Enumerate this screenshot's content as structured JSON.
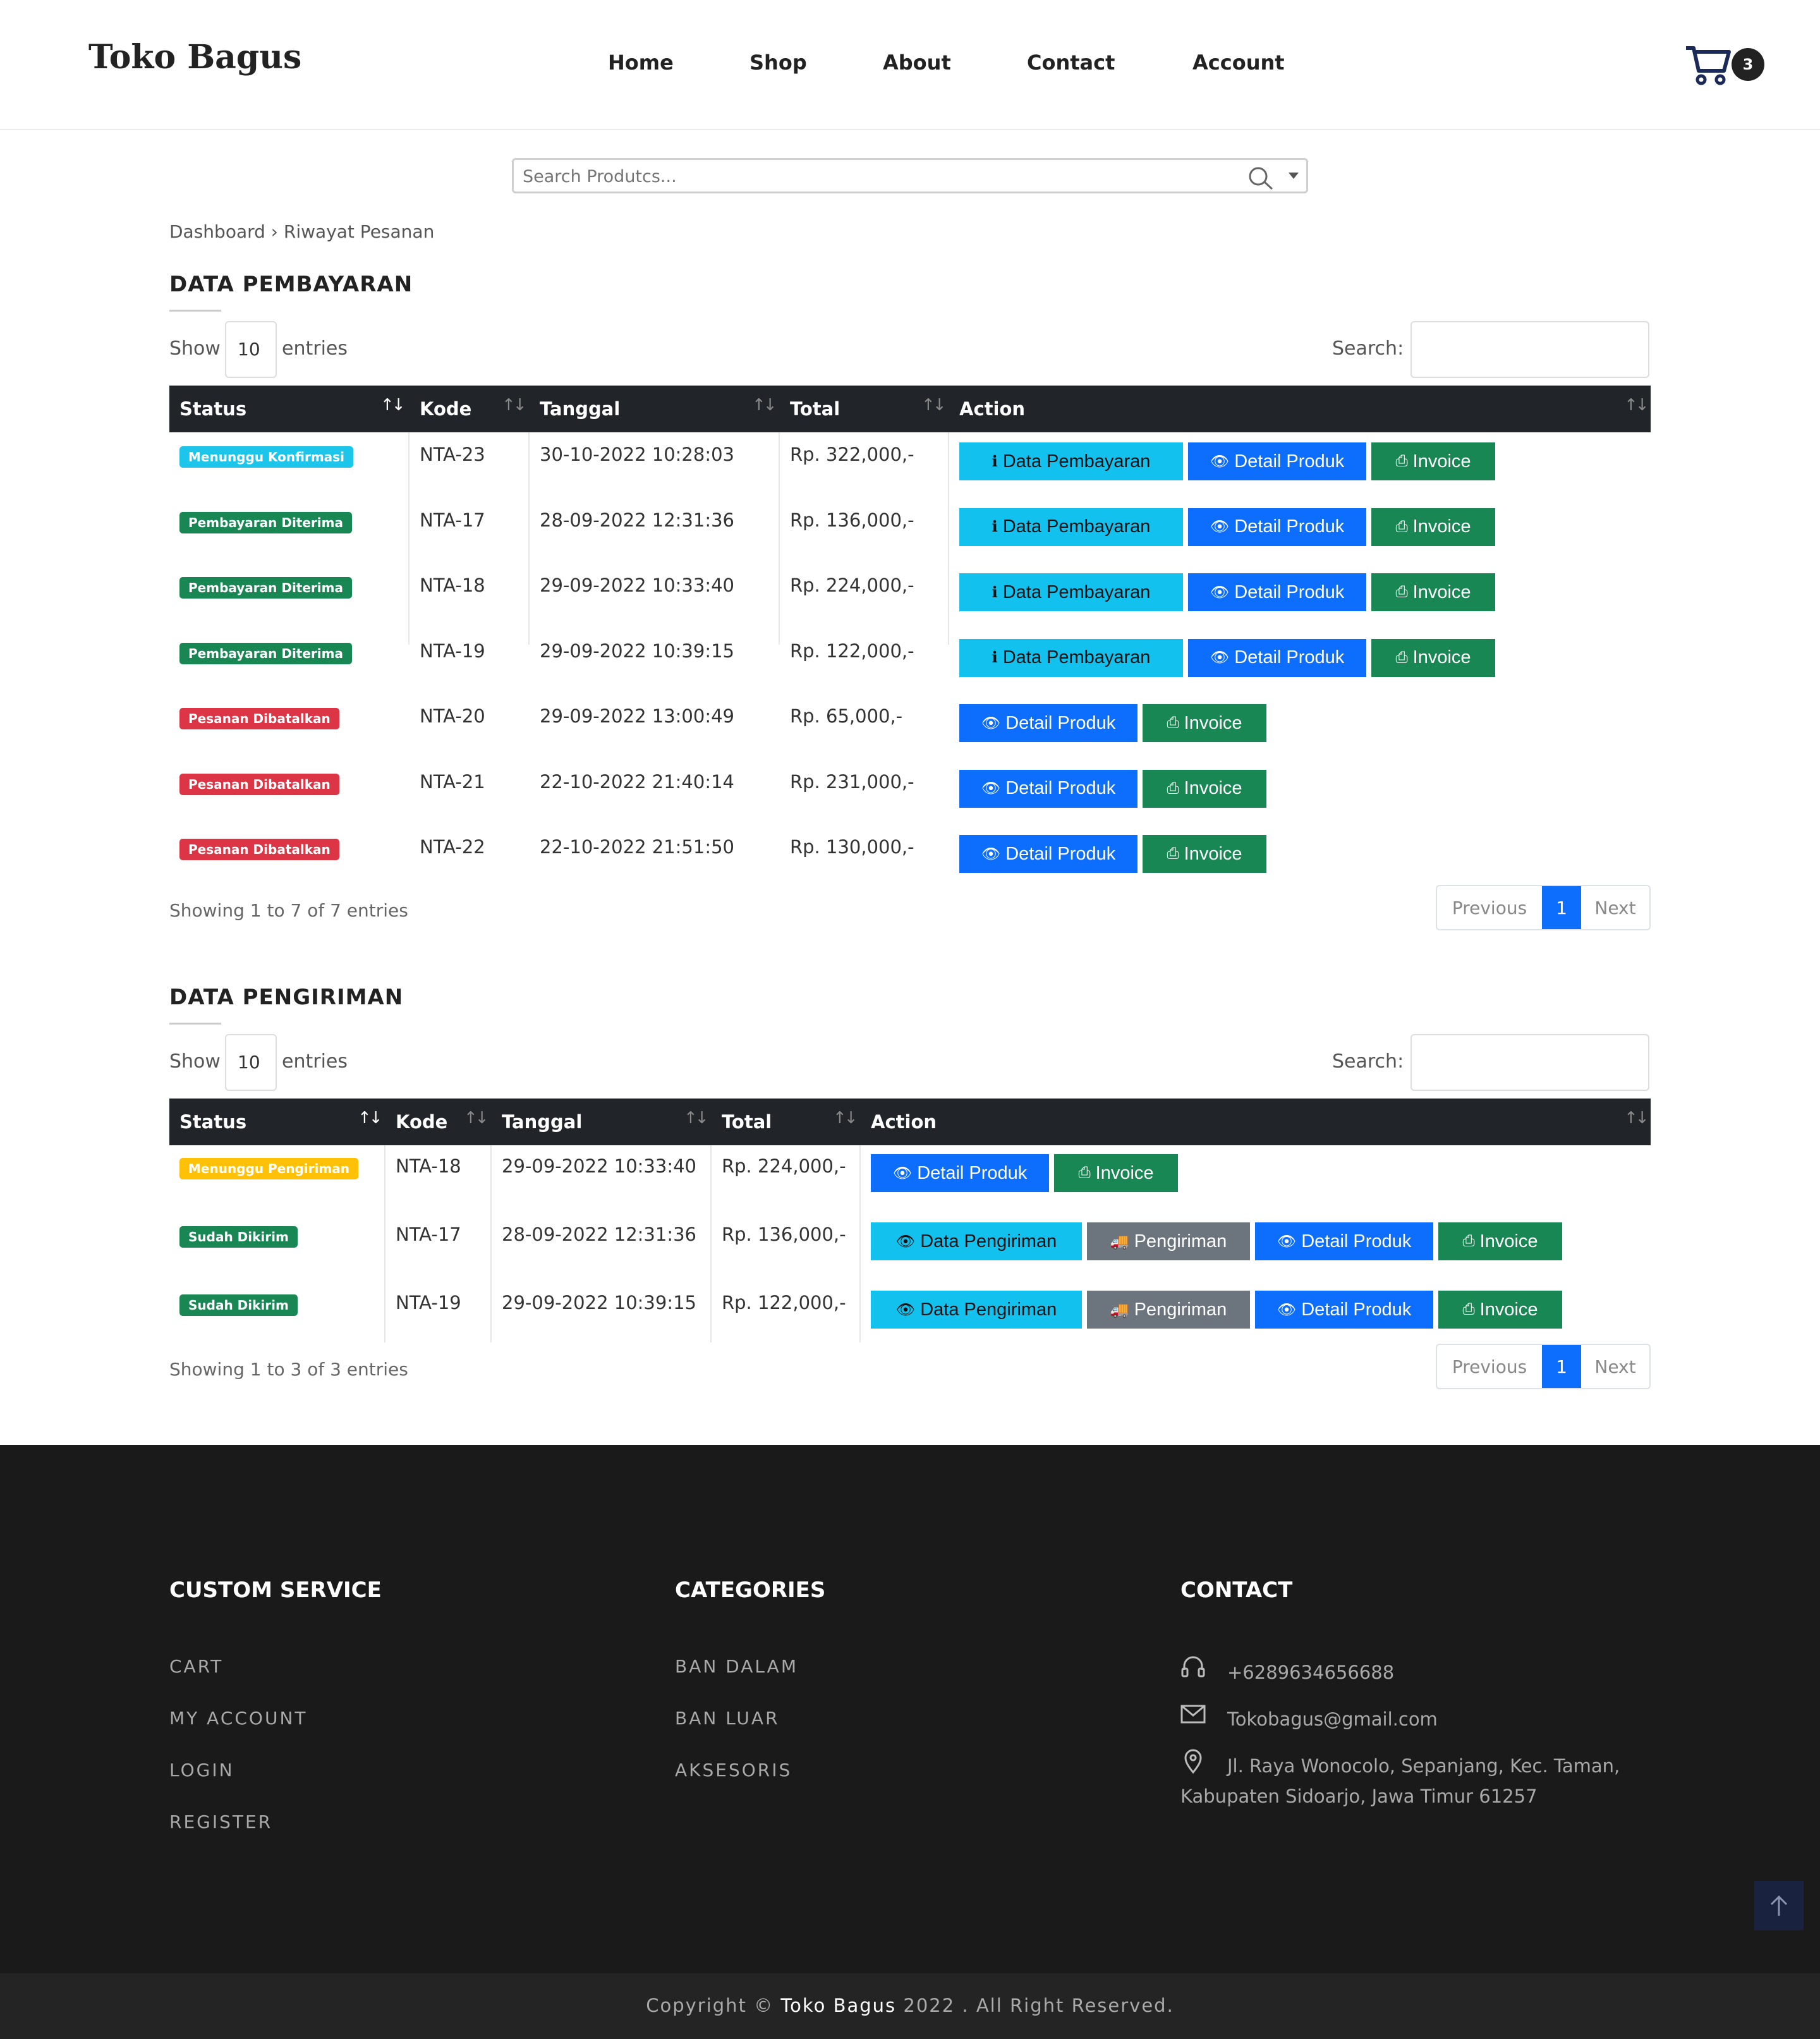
{
  "header": {
    "logo": "Toko Bagus",
    "nav": [
      "Home",
      "Shop",
      "About",
      "Contact",
      "Account"
    ],
    "cart_count": "3"
  },
  "search": {
    "placeholder": "Search Produtcs..."
  },
  "breadcrumb": "Dashboard › Riwayat Pesanan",
  "payment": {
    "title": "DATA PEMBAYARAN",
    "show_label": "Show",
    "show_value": "10",
    "entries_label": "entries",
    "search_label": "Search:",
    "columns": [
      "Status",
      "Kode",
      "Tanggal",
      "Total",
      "Action"
    ],
    "rows": [
      {
        "status": "Menunggu Konfirmasi",
        "status_type": "info",
        "kode": "NTA-23",
        "tanggal": "30-10-2022 10:28:03",
        "total": "Rp. 322,000,-",
        "actions": [
          "Data Pembayaran",
          "Detail Produk",
          "Invoice"
        ]
      },
      {
        "status": "Pembayaran Diterima",
        "status_type": "success",
        "kode": "NTA-17",
        "tanggal": "28-09-2022 12:31:36",
        "total": "Rp. 136,000,-",
        "actions": [
          "Data Pembayaran",
          "Detail Produk",
          "Invoice"
        ]
      },
      {
        "status": "Pembayaran Diterima",
        "status_type": "success",
        "kode": "NTA-18",
        "tanggal": "29-09-2022 10:33:40",
        "total": "Rp. 224,000,-",
        "actions": [
          "Data Pembayaran",
          "Detail Produk",
          "Invoice"
        ]
      },
      {
        "status": "Pembayaran Diterima",
        "status_type": "success",
        "kode": "NTA-19",
        "tanggal": "29-09-2022 10:39:15",
        "total": "Rp. 122,000,-",
        "actions": [
          "Data Pembayaran",
          "Detail Produk",
          "Invoice"
        ]
      },
      {
        "status": "Pesanan Dibatalkan",
        "status_type": "danger",
        "kode": "NTA-20",
        "tanggal": "29-09-2022 13:00:49",
        "total": "Rp. 65,000,-",
        "actions": [
          "Detail Produk",
          "Invoice"
        ]
      },
      {
        "status": "Pesanan Dibatalkan",
        "status_type": "danger",
        "kode": "NTA-21",
        "tanggal": "22-10-2022 21:40:14",
        "total": "Rp. 231,000,-",
        "actions": [
          "Detail Produk",
          "Invoice"
        ]
      },
      {
        "status": "Pesanan Dibatalkan",
        "status_type": "danger",
        "kode": "NTA-22",
        "tanggal": "22-10-2022 21:51:50",
        "total": "Rp. 130,000,-",
        "actions": [
          "Detail Produk",
          "Invoice"
        ]
      }
    ],
    "info": "Showing 1 to 7 of 7 entries",
    "pager": {
      "previous": "Previous",
      "page": "1",
      "next": "Next"
    }
  },
  "shipping": {
    "title": "DATA PENGIRIMAN",
    "show_label": "Show",
    "show_value": "10",
    "entries_label": "entries",
    "search_label": "Search:",
    "columns": [
      "Status",
      "Kode",
      "Tanggal",
      "Total",
      "Action"
    ],
    "rows": [
      {
        "status": "Menunggu Pengiriman",
        "status_type": "warning",
        "kode": "NTA-18",
        "tanggal": "29-09-2022 10:33:40",
        "total": "Rp. 224,000,-",
        "actions": [
          "Detail Produk",
          "Invoice"
        ]
      },
      {
        "status": "Sudah Dikirim",
        "status_type": "success",
        "kode": "NTA-17",
        "tanggal": "28-09-2022 12:31:36",
        "total": "Rp. 136,000,-",
        "actions": [
          "Data Pengiriman",
          "Pengiriman",
          "Detail Produk",
          "Invoice"
        ]
      },
      {
        "status": "Sudah Dikirim",
        "status_type": "success",
        "kode": "NTA-19",
        "tanggal": "29-09-2022 10:39:15",
        "total": "Rp. 122,000,-",
        "actions": [
          "Data Pengiriman",
          "Pengiriman",
          "Detail Produk",
          "Invoice"
        ]
      }
    ],
    "info": "Showing 1 to 3 of 3 entries",
    "pager": {
      "previous": "Previous",
      "page": "1",
      "next": "Next"
    }
  },
  "footer": {
    "custom_service": {
      "title": "CUSTOM SERVICE",
      "links": [
        "CART",
        "MY ACCOUNT",
        "LOGIN",
        "REGISTER"
      ]
    },
    "categories": {
      "title": "CATEGORIES",
      "links": [
        "BAN DALAM",
        "BAN LUAR",
        "AKSESORIS"
      ]
    },
    "contact": {
      "title": "CONTACT",
      "phone": "+6289634656688",
      "email": "Tokobagus@gmail.com",
      "address_line1": "Jl. Raya Wonocolo, Sepanjang, Kec. Taman,",
      "address_line2": "Kabupaten Sidoarjo, Jawa Timur 61257"
    },
    "copyright_prefix": "Copyright © ",
    "copyright_brand": "Toko Bagus",
    "copyright_suffix": " 2022 . All Right Reserved."
  },
  "colors": {
    "primary": "#0d6efd",
    "info": "#12c1ee",
    "success": "#198754",
    "danger": "#dc3545",
    "warning": "#ffc107",
    "secondary": "#6c757d",
    "table_header": "#212529",
    "footer_bg": "#1a1a1b"
  }
}
